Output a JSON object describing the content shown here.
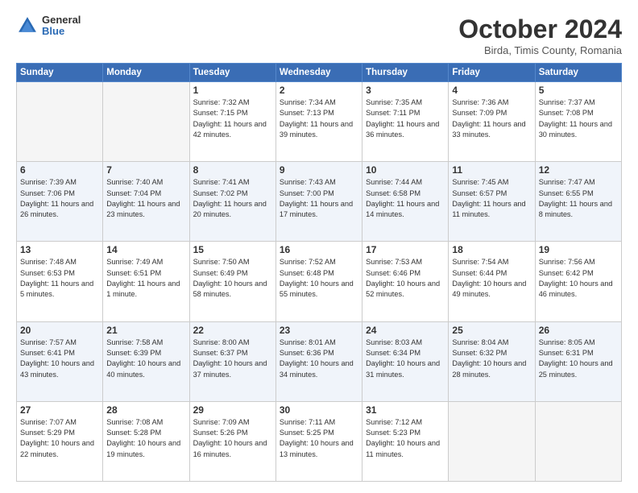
{
  "logo": {
    "line1": "General",
    "line2": "Blue"
  },
  "title": "October 2024",
  "subtitle": "Birda, Timis County, Romania",
  "days_header": [
    "Sunday",
    "Monday",
    "Tuesday",
    "Wednesday",
    "Thursday",
    "Friday",
    "Saturday"
  ],
  "weeks": [
    [
      {
        "num": "",
        "empty": true
      },
      {
        "num": "",
        "empty": true
      },
      {
        "num": "1",
        "rise": "7:32 AM",
        "set": "7:15 PM",
        "daylight": "11 hours and 42 minutes."
      },
      {
        "num": "2",
        "rise": "7:34 AM",
        "set": "7:13 PM",
        "daylight": "11 hours and 39 minutes."
      },
      {
        "num": "3",
        "rise": "7:35 AM",
        "set": "7:11 PM",
        "daylight": "11 hours and 36 minutes."
      },
      {
        "num": "4",
        "rise": "7:36 AM",
        "set": "7:09 PM",
        "daylight": "11 hours and 33 minutes."
      },
      {
        "num": "5",
        "rise": "7:37 AM",
        "set": "7:08 PM",
        "daylight": "11 hours and 30 minutes."
      }
    ],
    [
      {
        "num": "6",
        "rise": "7:39 AM",
        "set": "7:06 PM",
        "daylight": "11 hours and 26 minutes."
      },
      {
        "num": "7",
        "rise": "7:40 AM",
        "set": "7:04 PM",
        "daylight": "11 hours and 23 minutes."
      },
      {
        "num": "8",
        "rise": "7:41 AM",
        "set": "7:02 PM",
        "daylight": "11 hours and 20 minutes."
      },
      {
        "num": "9",
        "rise": "7:43 AM",
        "set": "7:00 PM",
        "daylight": "11 hours and 17 minutes."
      },
      {
        "num": "10",
        "rise": "7:44 AM",
        "set": "6:58 PM",
        "daylight": "11 hours and 14 minutes."
      },
      {
        "num": "11",
        "rise": "7:45 AM",
        "set": "6:57 PM",
        "daylight": "11 hours and 11 minutes."
      },
      {
        "num": "12",
        "rise": "7:47 AM",
        "set": "6:55 PM",
        "daylight": "11 hours and 8 minutes."
      }
    ],
    [
      {
        "num": "13",
        "rise": "7:48 AM",
        "set": "6:53 PM",
        "daylight": "11 hours and 5 minutes."
      },
      {
        "num": "14",
        "rise": "7:49 AM",
        "set": "6:51 PM",
        "daylight": "11 hours and 1 minute."
      },
      {
        "num": "15",
        "rise": "7:50 AM",
        "set": "6:49 PM",
        "daylight": "10 hours and 58 minutes."
      },
      {
        "num": "16",
        "rise": "7:52 AM",
        "set": "6:48 PM",
        "daylight": "10 hours and 55 minutes."
      },
      {
        "num": "17",
        "rise": "7:53 AM",
        "set": "6:46 PM",
        "daylight": "10 hours and 52 minutes."
      },
      {
        "num": "18",
        "rise": "7:54 AM",
        "set": "6:44 PM",
        "daylight": "10 hours and 49 minutes."
      },
      {
        "num": "19",
        "rise": "7:56 AM",
        "set": "6:42 PM",
        "daylight": "10 hours and 46 minutes."
      }
    ],
    [
      {
        "num": "20",
        "rise": "7:57 AM",
        "set": "6:41 PM",
        "daylight": "10 hours and 43 minutes."
      },
      {
        "num": "21",
        "rise": "7:58 AM",
        "set": "6:39 PM",
        "daylight": "10 hours and 40 minutes."
      },
      {
        "num": "22",
        "rise": "8:00 AM",
        "set": "6:37 PM",
        "daylight": "10 hours and 37 minutes."
      },
      {
        "num": "23",
        "rise": "8:01 AM",
        "set": "6:36 PM",
        "daylight": "10 hours and 34 minutes."
      },
      {
        "num": "24",
        "rise": "8:03 AM",
        "set": "6:34 PM",
        "daylight": "10 hours and 31 minutes."
      },
      {
        "num": "25",
        "rise": "8:04 AM",
        "set": "6:32 PM",
        "daylight": "10 hours and 28 minutes."
      },
      {
        "num": "26",
        "rise": "8:05 AM",
        "set": "6:31 PM",
        "daylight": "10 hours and 25 minutes."
      }
    ],
    [
      {
        "num": "27",
        "rise": "7:07 AM",
        "set": "5:29 PM",
        "daylight": "10 hours and 22 minutes."
      },
      {
        "num": "28",
        "rise": "7:08 AM",
        "set": "5:28 PM",
        "daylight": "10 hours and 19 minutes."
      },
      {
        "num": "29",
        "rise": "7:09 AM",
        "set": "5:26 PM",
        "daylight": "10 hours and 16 minutes."
      },
      {
        "num": "30",
        "rise": "7:11 AM",
        "set": "5:25 PM",
        "daylight": "10 hours and 13 minutes."
      },
      {
        "num": "31",
        "rise": "7:12 AM",
        "set": "5:23 PM",
        "daylight": "10 hours and 11 minutes."
      },
      {
        "num": "",
        "empty": true
      },
      {
        "num": "",
        "empty": true
      }
    ]
  ]
}
